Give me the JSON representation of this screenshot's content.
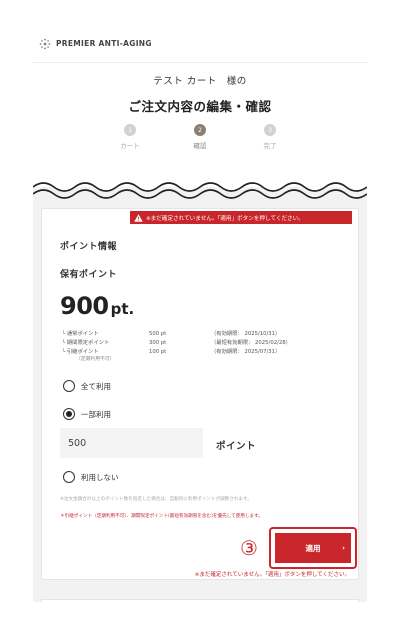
{
  "header": {
    "logo_text": "PREMIER ANTI-AGING"
  },
  "titles": {
    "sub": "テスト カート　様の",
    "main": "ご注文内容の編集・確認"
  },
  "steps": [
    {
      "num": "1",
      "label": "カート",
      "active": false
    },
    {
      "num": "2",
      "label": "確認",
      "active": true
    },
    {
      "num": "3",
      "label": "完了",
      "active": false
    }
  ],
  "alert": {
    "text": "※まだ確定されていません。「適用」ボタンを押してください。"
  },
  "points": {
    "section_title": "ポイント情報",
    "held_label": "保有ポイント",
    "value": "900",
    "unit": "pt.",
    "details": [
      {
        "name": "└ 通常ポイント",
        "amount": "500 pt",
        "expiry": "（有効期限： 2025/10/31）"
      },
      {
        "name": "└ 期間限定ポイント",
        "amount": "300 pt",
        "expiry": "（最短有効期限： 2025/02/28）"
      },
      {
        "name": "└ 引継ポイント",
        "amount": "100 pt",
        "expiry": "（有効期限： 2025/07/31）"
      }
    ],
    "detail_note": "（定期利用不可）"
  },
  "options": {
    "all": "全て利用",
    "partial": "一部利用",
    "none": "利用しない",
    "selected": "partial"
  },
  "input": {
    "value": "500",
    "unit": "ポイント"
  },
  "notes": {
    "gray": "※注文金額合計以上のポイント数を指定した場合は、自動的に利用ポイントが調整されます。",
    "red": "＊引継ポイント（定期利用不可）、期間限定ポイント(最短有効期限を含む)を優先して使用します。"
  },
  "apply": {
    "marker": "③",
    "label": "適用",
    "arrow": "›",
    "warning": "※まだ確定されていません。「適用」ボタンを押してください。"
  },
  "colors": {
    "accent": "#c8262a",
    "step_active": "#8b7f74",
    "step_inactive": "#d4d0cc"
  }
}
